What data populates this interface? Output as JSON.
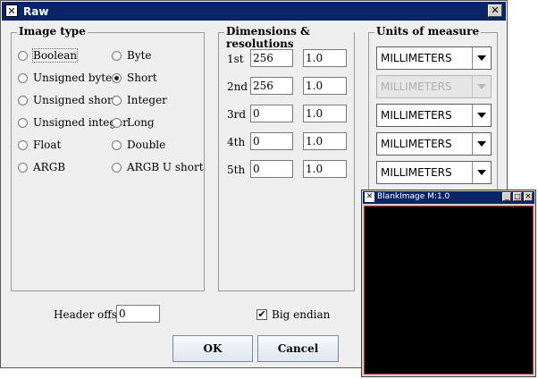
{
  "dialog": {
    "title": "Raw",
    "close_glyph": "✕",
    "icon": "app-icon",
    "image_type": {
      "title": "Image type",
      "options": [
        {
          "label": "Boolean",
          "checked": false
        },
        {
          "label": "Byte",
          "checked": false
        },
        {
          "label": "Unsigned byte",
          "checked": false
        },
        {
          "label": "Short",
          "checked": true
        },
        {
          "label": "Unsigned short",
          "checked": false
        },
        {
          "label": "Integer",
          "checked": false
        },
        {
          "label": "Unsigned integer",
          "checked": false
        },
        {
          "label": "Long",
          "checked": false
        },
        {
          "label": "Float",
          "checked": false
        },
        {
          "label": "Double",
          "checked": false
        },
        {
          "label": "ARGB",
          "checked": false
        },
        {
          "label": "ARGB U short",
          "checked": false
        }
      ]
    },
    "dimensions": {
      "title": "Dimensions & resolutions",
      "rows": [
        {
          "label": "1st",
          "dim": "256",
          "res": "1.0"
        },
        {
          "label": "2nd",
          "dim": "256",
          "res": "1.0"
        },
        {
          "label": "3rd",
          "dim": "0",
          "res": "1.0"
        },
        {
          "label": "4th",
          "dim": "0",
          "res": "1.0"
        },
        {
          "label": "5th",
          "dim": "0",
          "res": "1.0"
        }
      ]
    },
    "units": {
      "title": "Units of measure",
      "combos": [
        {
          "value": "MILLIMETERS",
          "enabled": true
        },
        {
          "value": "MILLIMETERS",
          "enabled": false
        },
        {
          "value": "MILLIMETERS",
          "enabled": true
        },
        {
          "value": "MILLIMETERS",
          "enabled": true
        },
        {
          "value": "MILLIMETERS",
          "enabled": true
        }
      ]
    },
    "header_offset": {
      "label": "Header offset",
      "value": "0"
    },
    "big_endian": {
      "label": "Big endian",
      "checked": true,
      "check_glyph": "✔"
    },
    "ok_label": "OK",
    "cancel_label": "Cancel"
  },
  "blank_window": {
    "title": "BlankImage  M:1.0",
    "min_glyph": "_",
    "max_glyph": "□",
    "close_glyph": "✕",
    "canvas_color": "#000000"
  }
}
